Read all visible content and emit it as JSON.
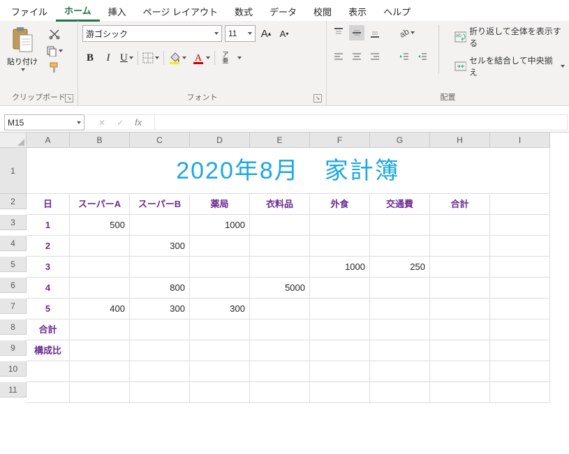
{
  "menu": {
    "items": [
      "ファイル",
      "ホーム",
      "挿入",
      "ページ レイアウト",
      "数式",
      "データ",
      "校閲",
      "表示",
      "ヘルプ"
    ],
    "active_index": 1
  },
  "ribbon": {
    "clipboard": {
      "paste": "貼り付け",
      "group_label": "クリップボード"
    },
    "font": {
      "name": "游ゴシック",
      "size": "11",
      "bold": "B",
      "italic": "I",
      "underline": "U",
      "ruby": "ア\n亜",
      "group_label": "フォント"
    },
    "alignment": {
      "wrap_text": "折り返して全体を表示する",
      "merge_center": "セルを結合して中央揃え",
      "group_label": "配置"
    }
  },
  "formula_bar": {
    "namebox": "M15",
    "fx": "fx",
    "value": ""
  },
  "grid": {
    "columns": [
      "A",
      "B",
      "C",
      "D",
      "E",
      "F",
      "G",
      "H",
      "I"
    ],
    "row_numbers": [
      1,
      2,
      3,
      4,
      5,
      6,
      7,
      8,
      9,
      10,
      11
    ],
    "title": "2020年8月　家計簿",
    "headers": [
      "日",
      "スーパーA",
      "スーパーB",
      "薬局",
      "衣料品",
      "外食",
      "交通費",
      "合計"
    ],
    "rows": [
      {
        "day": "1",
        "cells": [
          "500",
          "",
          "1000",
          "",
          "",
          "",
          "",
          ""
        ]
      },
      {
        "day": "2",
        "cells": [
          "",
          "300",
          "",
          "",
          "",
          "",
          "",
          ""
        ]
      },
      {
        "day": "3",
        "cells": [
          "",
          "",
          "",
          "",
          "1000",
          "250",
          "",
          ""
        ]
      },
      {
        "day": "4",
        "cells": [
          "",
          "800",
          "",
          "5000",
          "",
          "",
          "",
          ""
        ]
      },
      {
        "day": "5",
        "cells": [
          "400",
          "300",
          "300",
          "",
          "",
          "",
          "",
          ""
        ]
      }
    ],
    "totals_label": "合計",
    "ratio_label": "構成比"
  }
}
